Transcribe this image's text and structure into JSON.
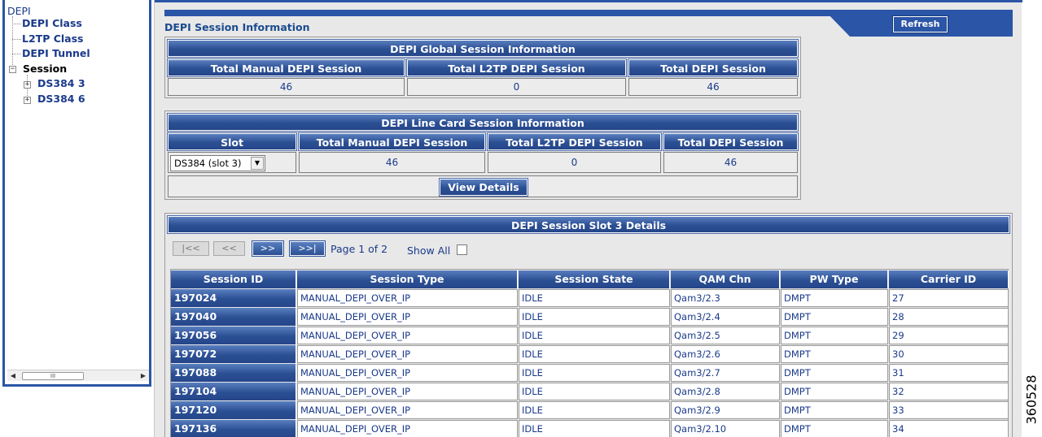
{
  "tree": {
    "root": "DEPI",
    "items": [
      {
        "label": "DEPI Class"
      },
      {
        "label": "L2TP Class"
      },
      {
        "label": "DEPI Tunnel"
      },
      {
        "label": "Session"
      }
    ],
    "session_children": [
      {
        "label": "DS384 3"
      },
      {
        "label": "DS384 6"
      }
    ],
    "scrollbar_thumb_glyph": "III"
  },
  "header": {
    "title": "DEPI Session Information",
    "refresh_label": "Refresh"
  },
  "global_info": {
    "title": "DEPI Global Session Information",
    "columns": [
      "Total Manual DEPI Session",
      "Total L2TP DEPI Session",
      "Total DEPI Session"
    ],
    "values": [
      "46",
      "0",
      "46"
    ]
  },
  "line_card_info": {
    "title": "DEPI Line Card Session Information",
    "columns": [
      "Slot",
      "Total Manual DEPI Session",
      "Total L2TP DEPI Session",
      "Total DEPI Session"
    ],
    "slot_selected": "DS384 (slot 3)",
    "values": [
      "46",
      "0",
      "46"
    ],
    "view_details_label": "View Details"
  },
  "details": {
    "title": "DEPI Session Slot 3 Details",
    "pager": {
      "first": "|<<",
      "prev": "<<",
      "next": ">>",
      "last": ">>|",
      "page_text": "Page 1 of 2",
      "show_all_label": "Show All"
    },
    "columns": [
      "Session ID",
      "Session Type",
      "Session State",
      "QAM Chn",
      "PW Type",
      "Carrier ID"
    ],
    "rows": [
      [
        "197024",
        "MANUAL_DEPI_OVER_IP",
        "IDLE",
        "Qam3/2.3",
        "DMPT",
        "27"
      ],
      [
        "197040",
        "MANUAL_DEPI_OVER_IP",
        "IDLE",
        "Qam3/2.4",
        "DMPT",
        "28"
      ],
      [
        "197056",
        "MANUAL_DEPI_OVER_IP",
        "IDLE",
        "Qam3/2.5",
        "DMPT",
        "29"
      ],
      [
        "197072",
        "MANUAL_DEPI_OVER_IP",
        "IDLE",
        "Qam3/2.6",
        "DMPT",
        "30"
      ],
      [
        "197088",
        "MANUAL_DEPI_OVER_IP",
        "IDLE",
        "Qam3/2.7",
        "DMPT",
        "31"
      ],
      [
        "197104",
        "MANUAL_DEPI_OVER_IP",
        "IDLE",
        "Qam3/2.8",
        "DMPT",
        "32"
      ],
      [
        "197120",
        "MANUAL_DEPI_OVER_IP",
        "IDLE",
        "Qam3/2.9",
        "DMPT",
        "33"
      ],
      [
        "197136",
        "MANUAL_DEPI_OVER_IP",
        "IDLE",
        "Qam3/2.10",
        "DMPT",
        "34"
      ]
    ]
  },
  "figure_number": "360528",
  "colors": {
    "header_blue": "#2b55a6",
    "panel_bg": "#e8e8e8",
    "text_blue": "#1a3a8a"
  }
}
